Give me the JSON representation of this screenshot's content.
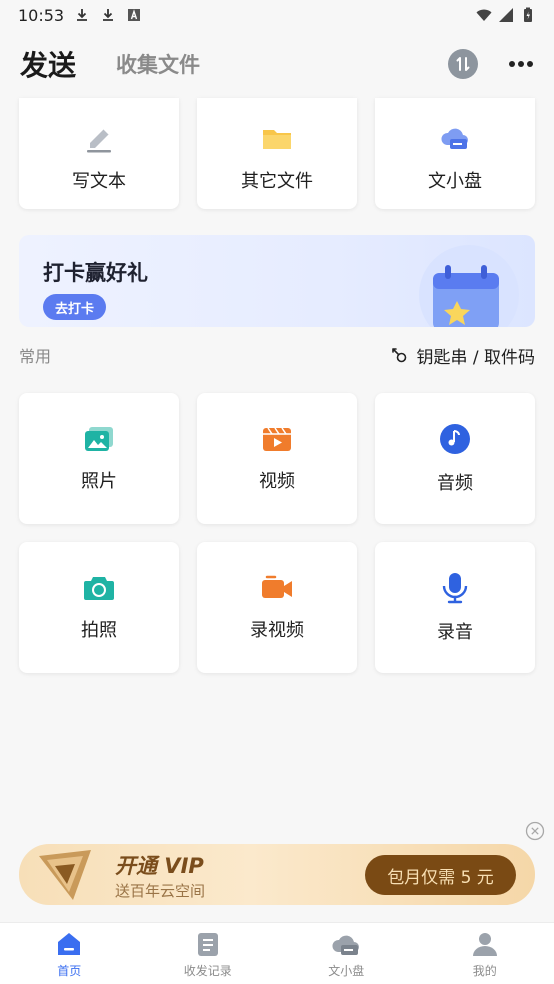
{
  "status_bar": {
    "time": "10:53"
  },
  "header": {
    "tab_send": "发送",
    "tab_collect": "收集文件"
  },
  "top_cards": [
    {
      "label": "写文本",
      "icon": "pencil-icon"
    },
    {
      "label": "其它文件",
      "icon": "folder-icon"
    },
    {
      "label": "文小盘",
      "icon": "cloud-disk-icon"
    }
  ],
  "promo": {
    "title": "打卡赢好礼",
    "button": "去打卡"
  },
  "section": {
    "title": "常用",
    "keychain_label": "钥匙串 / 取件码"
  },
  "common_cards": [
    {
      "label": "照片",
      "icon": "photo-icon",
      "color": "#1fb3a4"
    },
    {
      "label": "视频",
      "icon": "video-icon",
      "color": "#f07c2c"
    },
    {
      "label": "音频",
      "icon": "music-icon",
      "color": "#2f62e0"
    },
    {
      "label": "拍照",
      "icon": "camera-icon",
      "color": "#1fb3a4"
    },
    {
      "label": "录视频",
      "icon": "video-camera-icon",
      "color": "#f07c2c"
    },
    {
      "label": "录音",
      "icon": "microphone-icon",
      "color": "#2f62e0"
    }
  ],
  "vip": {
    "title": "开通 VIP",
    "subtitle": "送百年云空间",
    "cta": "包月仅需 5 元"
  },
  "bottom_nav": [
    {
      "label": "首页",
      "icon": "home-icon",
      "active": true
    },
    {
      "label": "收发记录",
      "icon": "records-icon",
      "active": false
    },
    {
      "label": "文小盘",
      "icon": "cloud-disk-icon",
      "active": false
    },
    {
      "label": "我的",
      "icon": "profile-icon",
      "active": false
    }
  ],
  "colors": {
    "accent": "#3a6ef0",
    "teal": "#1fb3a4",
    "orange": "#f07c2c",
    "blue": "#2f62e0",
    "vip_brown": "#7a4a14"
  }
}
